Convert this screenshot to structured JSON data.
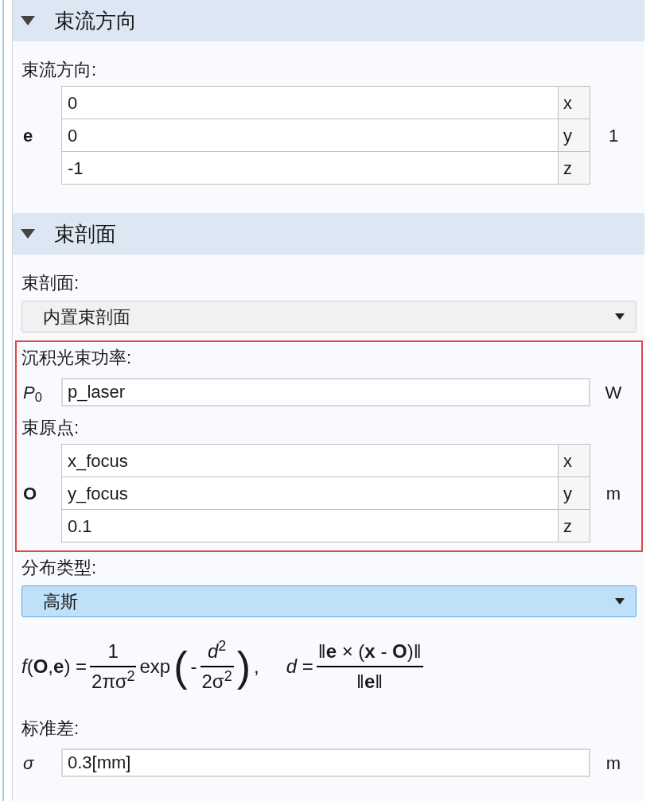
{
  "sections": [
    {
      "title": "束流方向",
      "expanded": true,
      "items": [
        {
          "kind": "label",
          "text": "束流方向:"
        },
        {
          "kind": "vector",
          "symbol": "e",
          "unit": "1",
          "components": [
            {
              "value": "0",
              "axis": "x"
            },
            {
              "value": "0",
              "axis": "y"
            },
            {
              "value": "-1",
              "axis": "z"
            }
          ]
        }
      ]
    },
    {
      "title": "束剖面",
      "expanded": true,
      "items": [
        {
          "kind": "label",
          "text": "束剖面:"
        },
        {
          "kind": "dropdown",
          "value": "内置束剖面",
          "focused": false
        },
        {
          "kind": "highlight",
          "items": [
            {
              "kind": "label",
              "text": "沉积光束功率:"
            },
            {
              "kind": "scalar",
              "symbol": "*P*$_{0}$",
              "value": "p_laser",
              "unit": "W"
            },
            {
              "kind": "label",
              "text": "束原点:"
            },
            {
              "kind": "vector",
              "symbol": "O",
              "unit": "m",
              "components": [
                {
                  "value": "x_focus",
                  "axis": "x"
                },
                {
                  "value": "y_focus",
                  "axis": "y"
                },
                {
                  "value": "0.1",
                  "axis": "z"
                }
              ]
            }
          ]
        },
        {
          "kind": "label",
          "text": "分布类型:"
        },
        {
          "kind": "dropdown",
          "value": "高斯",
          "focused": true
        },
        {
          "kind": "formula",
          "parts": [
            {
              "kind": "text",
              "text": "*f*(**O**,**e**) ="
            },
            {
              "kind": "frac",
              "num": "1",
              "den": "2πσ$^{2}$"
            },
            {
              "kind": "text",
              "text": "exp"
            },
            {
              "kind": "paren",
              "text": "("
            },
            {
              "kind": "text",
              "text": "-"
            },
            {
              "kind": "frac",
              "num": "*d*$^{2}$",
              "den": "2σ$^{2}$"
            },
            {
              "kind": "paren",
              "text": ")"
            },
            {
              "kind": "text",
              "text": ","
            },
            {
              "kind": "gap"
            },
            {
              "kind": "text",
              "text": "*d* ="
            },
            {
              "kind": "frac",
              "num": "‖**e** × (**x** - **O**)‖",
              "den": "‖**e**‖"
            }
          ]
        },
        {
          "kind": "label",
          "text": "标准差:"
        },
        {
          "kind": "scalar",
          "symbol": "*σ*",
          "value": "0.3[mm]",
          "unit": "m"
        }
      ]
    }
  ]
}
